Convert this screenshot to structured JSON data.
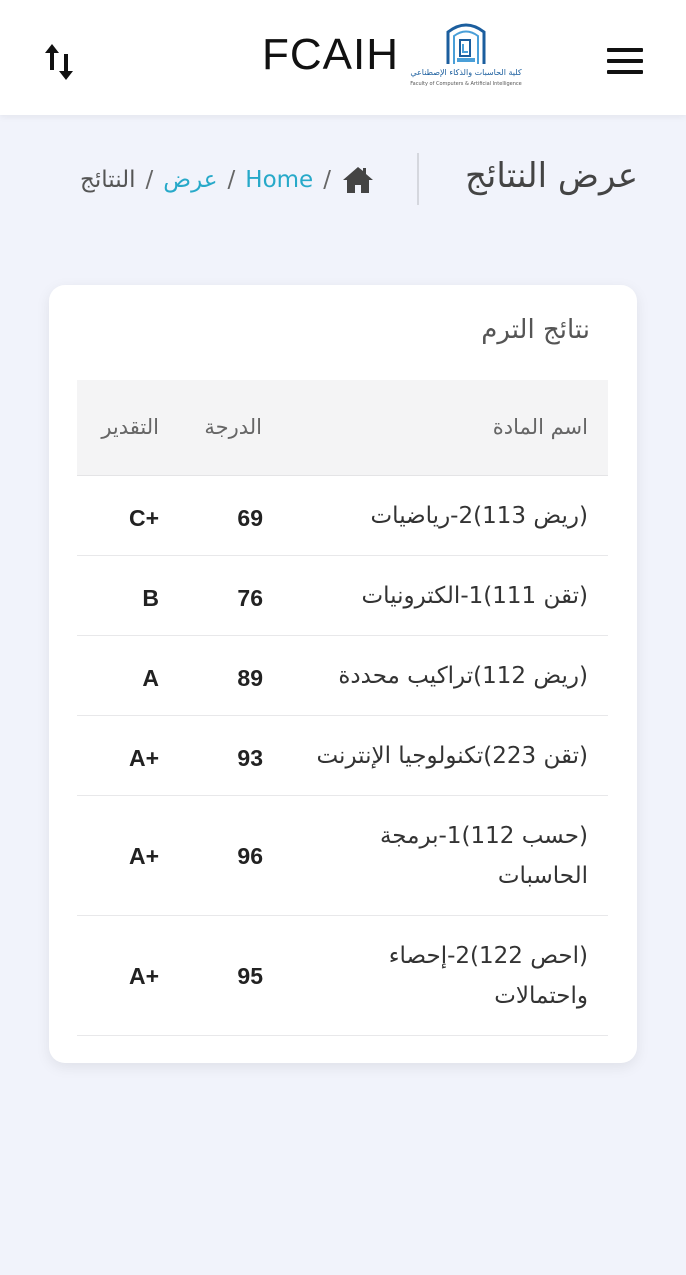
{
  "header": {
    "app_title": "FCAIH",
    "logo_text_ar": "كلية الحاسبات والذكاء الإصطناعي",
    "logo_text_en": "Faculty of Computers & Artificial Intelligence",
    "icons": {
      "sort": "sort-arrows-icon",
      "menu": "hamburger-menu-icon",
      "logo": "college-logo-icon"
    }
  },
  "page": {
    "title": "عرض النتائج",
    "breadcrumb": [
      {
        "label": "",
        "icon": "home-icon"
      },
      {
        "label": "Home"
      },
      {
        "label": "عرض"
      },
      {
        "label": "النتائج"
      }
    ],
    "separator": "/"
  },
  "card": {
    "title": "نتائج الترم",
    "columns": {
      "subject": "اسم المادة",
      "score": "الدرجة",
      "grade": "التقدير"
    },
    "rows": [
      {
        "subject": "(ريض 113)2-رياضيات",
        "score": "69",
        "grade": "+C"
      },
      {
        "subject": "(تقن 111)1-الكترونيات",
        "score": "76",
        "grade": "B"
      },
      {
        "subject": "(ريض 112)تراكيب محددة",
        "score": "89",
        "grade": "A"
      },
      {
        "subject": "(تقن 223)تكنولوجيا الإنترنت",
        "score": "93",
        "grade": "+A"
      },
      {
        "subject": "(حسب 112)1-برمجة الحاسبات",
        "score": "96",
        "grade": "+A"
      },
      {
        "subject": "(احص 122)2-إحصاء واحتمالات",
        "score": "95",
        "grade": "+A"
      }
    ]
  },
  "colors": {
    "background": "#f1f3fb",
    "link": "#27a9c9",
    "header_bg": "#ffffff",
    "logo_blue": "#1b5e9e"
  }
}
